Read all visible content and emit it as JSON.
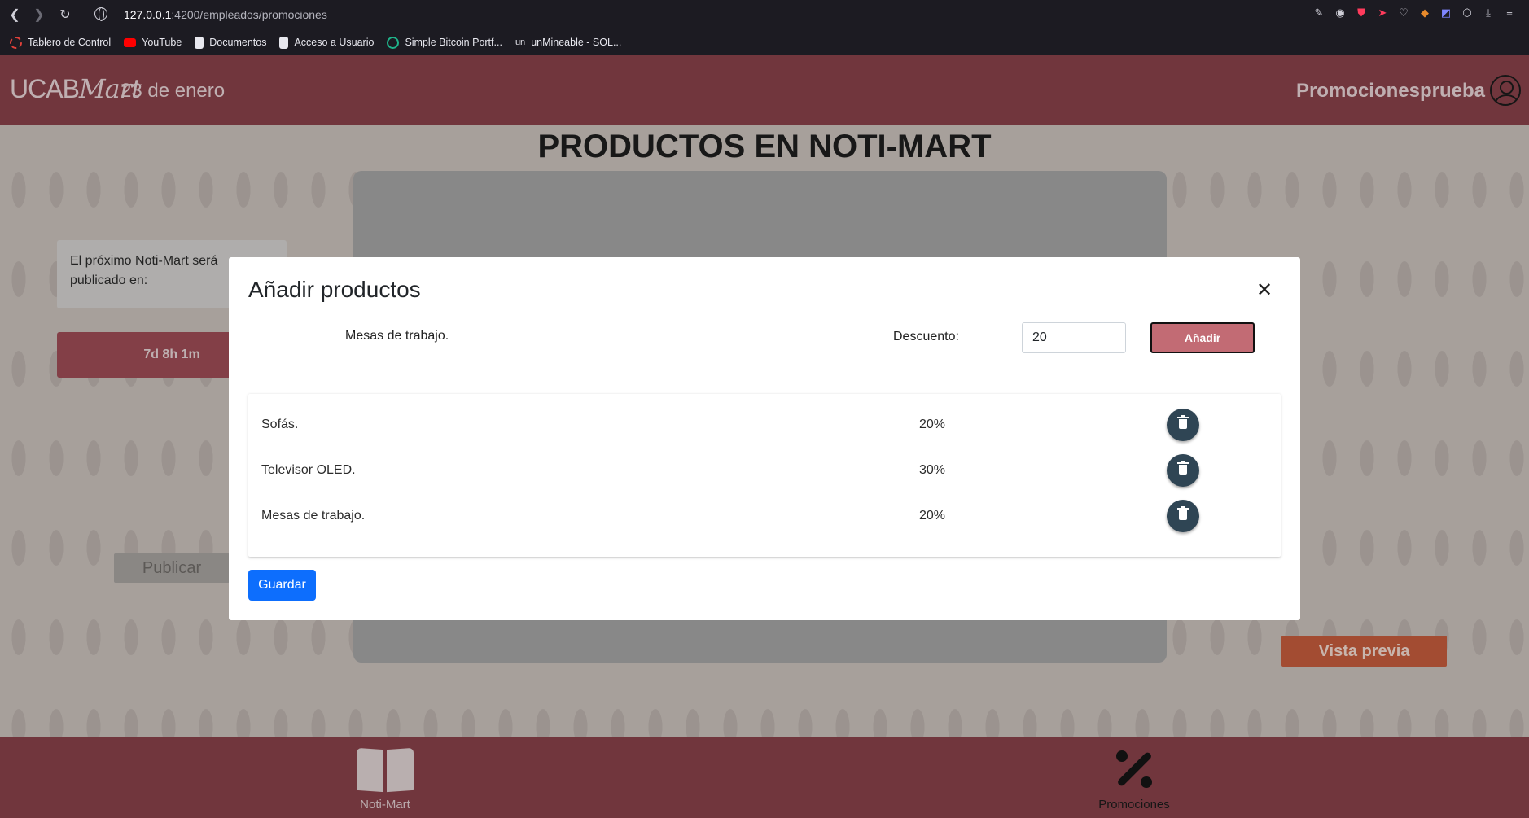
{
  "browser": {
    "url_host": "127.0.0.1",
    "url_path": ":4200/empleados/promociones",
    "bookmarks": [
      {
        "label": "Tablero de Control",
        "color": "#e0413a"
      },
      {
        "label": "YouTube",
        "color": "#ff0000"
      },
      {
        "label": "Documentos",
        "color": "#e8e8ef"
      },
      {
        "label": "Acceso a Usuario",
        "color": "#e8e8ef"
      },
      {
        "label": "Simple Bitcoin Portf...",
        "color": "#1fb38a"
      },
      {
        "label": "unMineable - SOL...",
        "color": "#1c1b22",
        "prefix": "un"
      }
    ]
  },
  "header": {
    "logo_ucab": "UCAB",
    "logo_mart": "Mart",
    "date": "23 de enero",
    "username": "Promocionesprueba"
  },
  "page": {
    "title": "PRODUCTOS EN NOTI-MART",
    "notice": "El próximo Noti-Mart será publicado en:",
    "countdown": "7d 8h 1m",
    "publish_label": "Publicar",
    "preview_label": "Vista previa"
  },
  "footer": {
    "noti_label": "Noti-Mart",
    "promo_label": "Promociones"
  },
  "modal": {
    "title": "Añadir productos",
    "close_symbol": "✕",
    "selected_product": "Mesas de trabajo.",
    "discount_label": "Descuento:",
    "discount_value": "20",
    "add_label": "Añadir",
    "save_label": "Guardar",
    "items": [
      {
        "name": "Sofás.",
        "discount": "20%"
      },
      {
        "name": "Televisor OLED.",
        "discount": "30%"
      },
      {
        "name": "Mesas de trabajo.",
        "discount": "20%"
      }
    ]
  },
  "colors": {
    "brand": "#8a434b",
    "add_button": "#c26b74",
    "save_button": "#0d6efd",
    "delete_button": "#2f4554",
    "preview_button": "#c75d3d"
  }
}
